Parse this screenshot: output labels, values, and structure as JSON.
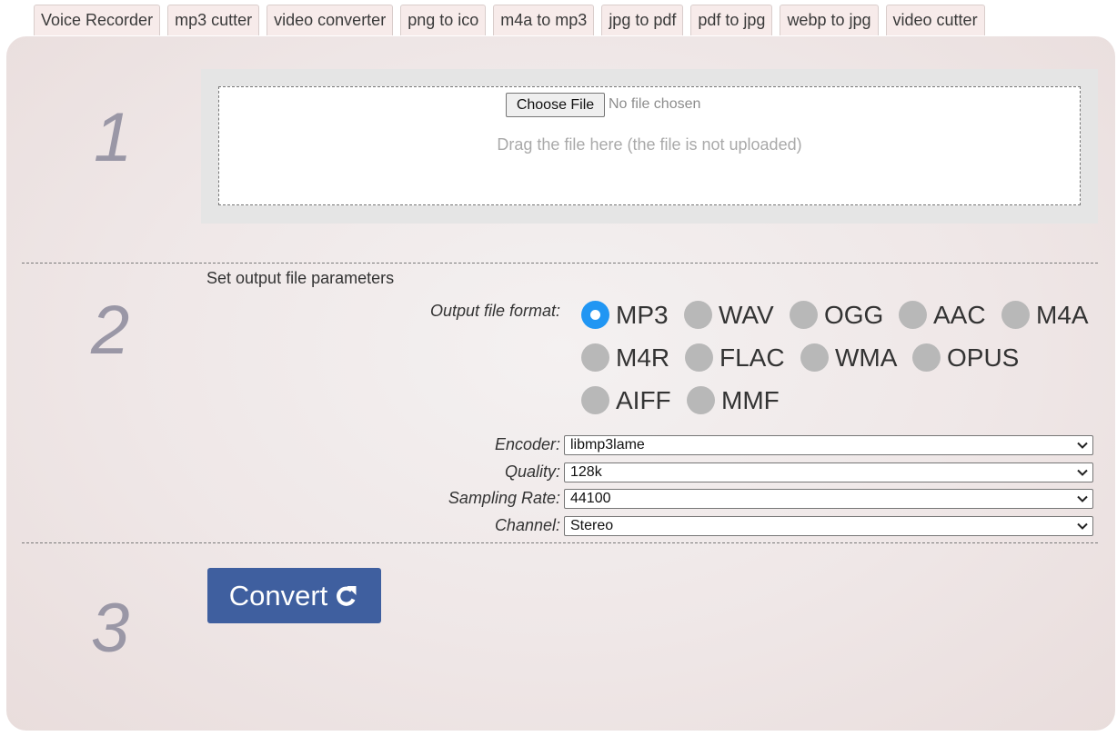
{
  "tabs": [
    "Voice Recorder",
    "mp3 cutter",
    "video converter",
    "png to ico",
    "m4a to mp3",
    "jpg to pdf",
    "pdf to jpg",
    "webp to jpg",
    "video cutter"
  ],
  "steps": {
    "one": "1",
    "two": "2",
    "three": "3"
  },
  "upload": {
    "choose_label": "Choose File",
    "no_file": "No file chosen",
    "drag_hint": "Drag the file here (the file is not uploaded)"
  },
  "params": {
    "title": "Set output file parameters",
    "format_label": "Output file format:",
    "formats": [
      "MP3",
      "WAV",
      "OGG",
      "AAC",
      "M4A",
      "M4R",
      "FLAC",
      "WMA",
      "OPUS",
      "AIFF",
      "MMF"
    ],
    "selected_format": "MP3",
    "encoder": {
      "label": "Encoder:",
      "value": "libmp3lame"
    },
    "quality": {
      "label": "Quality:",
      "value": "128k"
    },
    "sampling_rate": {
      "label": "Sampling Rate:",
      "value": "44100"
    },
    "channel": {
      "label": "Channel:",
      "value": "Stereo"
    }
  },
  "convert": {
    "label": "Convert"
  },
  "colors": {
    "accent": "#2196f3",
    "button": "#3f5f9f",
    "tab": "#f7ebea",
    "step_number": "#9a97a6"
  },
  "icons": {
    "convert": "refresh-icon",
    "select": "chevron-down-icon"
  }
}
